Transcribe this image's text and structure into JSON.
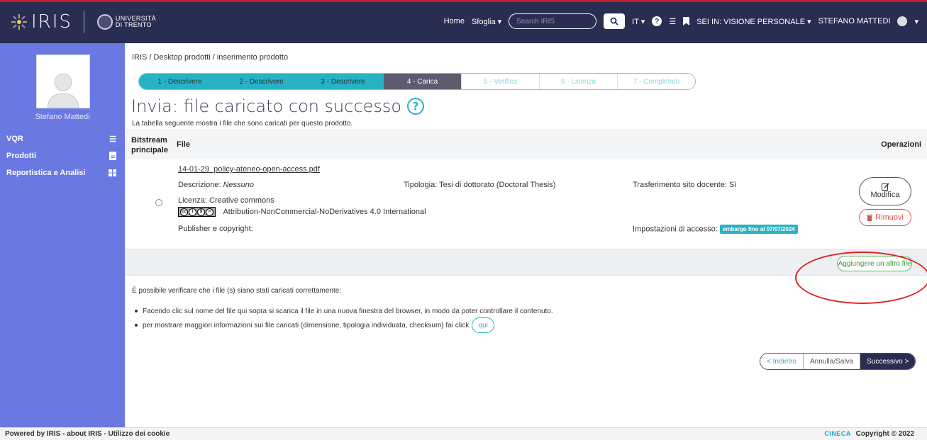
{
  "navbar": {
    "logo_text": "IRIS",
    "university": "UNIVERSITÀ\nDI TRENTO",
    "home": "Home",
    "sfoglia": "Sfoglia ▾",
    "search_placeholder": "Search IRIS",
    "lang": "IT ▾",
    "view": "SEI IN: VISIONE PERSONALE ▾",
    "user": "STEFANO MATTEDI",
    "user_caret": "▾"
  },
  "sidebar": {
    "user_name": "Stefano Mattedi",
    "items": [
      {
        "label": "VQR",
        "icon": "list-icon"
      },
      {
        "label": "Prodotti",
        "icon": "document-icon"
      },
      {
        "label": "Reportistica e Analisi",
        "icon": "grid-icon"
      }
    ]
  },
  "breadcrumb": "IRIS / Desktop prodotti / inserimento prodotto",
  "steps": [
    {
      "label": "1 - Descrivere",
      "state": "done"
    },
    {
      "label": "2 - Descrivere",
      "state": "done"
    },
    {
      "label": "3 - Descrivere",
      "state": "done"
    },
    {
      "label": "4 - Carica",
      "state": "active"
    },
    {
      "label": "5 - Verifica",
      "state": "todo"
    },
    {
      "label": "6 - Licenza",
      "state": "todo"
    },
    {
      "label": "7 - Completato",
      "state": "todo"
    }
  ],
  "title": "Invia: file caricato con successo",
  "subtitle": "La tabella seguente mostra i file che sono caricati per questo prodotto.",
  "table": {
    "col_bitstream": "Bitstream principale",
    "col_bitstream_1": "Bitstream",
    "col_bitstream_2": "principale",
    "col_file": "File",
    "col_ops": "Operazioni",
    "row": {
      "filename": "14-01-29_policy-ateneo-open-access.pdf",
      "descrizione_label": "Descrizione: ",
      "descrizione_value": "Nessuno",
      "tipologia": "Tipologia: Tesi di dottorato (Doctoral Thesis)",
      "trasferimento": "Trasferimento sito docente: Sì",
      "licenza": "Licenza: Creative commons",
      "licenza_name": "Attribution-NonCommercial-NoDerivatives 4.0 International",
      "publisher": "Publisher e copyright:",
      "accesso_label": "Impostazioni di accesso:",
      "embargo": "embargo fino al 07/07/2024",
      "modifica": "Modifica",
      "rimuovi": "Rimuovi"
    },
    "add_file": "Aggiungere un altro file"
  },
  "info": "È possibile verificare che i file (s) siano stati caricati correttamente:",
  "bullets": [
    "Facendo clic sul nome del file qui sopra si scarica il file in una nuova finestra del browser, in modo da poter controllare il contenuto.",
    "per mostrare maggiori informazioni sui file caricati (dimensione, tipologia individuata, checksum) fai click"
  ],
  "qui": "qui",
  "pager": {
    "back": "< Indietro",
    "cancel": "Annulla/Salva",
    "next": "Successivo >"
  },
  "footer": {
    "left": "Powered by IRIS  -  about IRIS  -  Utilizzo dei cookie",
    "cineca": "CINECA",
    "copyright": "Copyright © 2022"
  },
  "colors": {
    "navbar": "#2a2d52",
    "sidebar": "#6a78e2",
    "accent": "#27b3c4",
    "danger": "#d9534f",
    "success": "#5cb85c"
  }
}
